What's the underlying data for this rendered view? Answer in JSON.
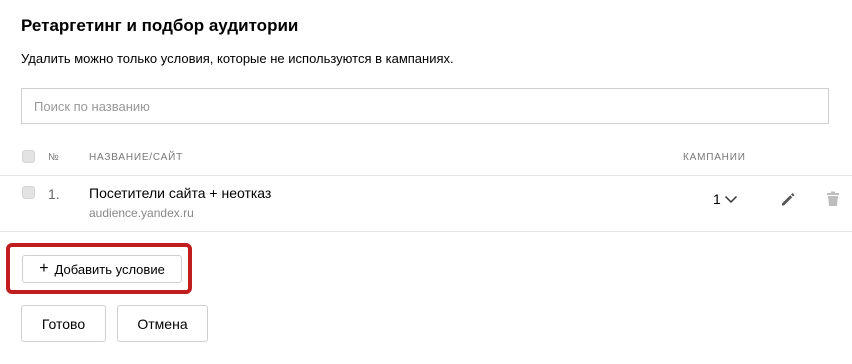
{
  "dialog": {
    "title": "Ретаргетинг и подбор аудитории",
    "subtitle": "Удалить можно только условия, которые не используются в кампаниях."
  },
  "search": {
    "placeholder": "Поиск по названию",
    "value": ""
  },
  "table": {
    "headers": {
      "number": "№",
      "name": "НАЗВАНИЕ/САЙТ",
      "campaigns": "КАМПАНИИ"
    },
    "rows": [
      {
        "number": "1.",
        "name": "Посетители сайта + неотказ",
        "site": "audience.yandex.ru",
        "campaigns": "1",
        "icons": [
          "chevron-down-icon",
          "pencil-icon",
          "trash-icon"
        ]
      }
    ]
  },
  "actions": {
    "add_icon": "+",
    "add_condition": "Добавить условие",
    "done": "Готово",
    "cancel": "Отмена"
  },
  "colors": {
    "highlight": "#c01e1e",
    "border": "#cfcfcf",
    "icon": "#555555",
    "icon_disabled": "#bdbdbd"
  }
}
